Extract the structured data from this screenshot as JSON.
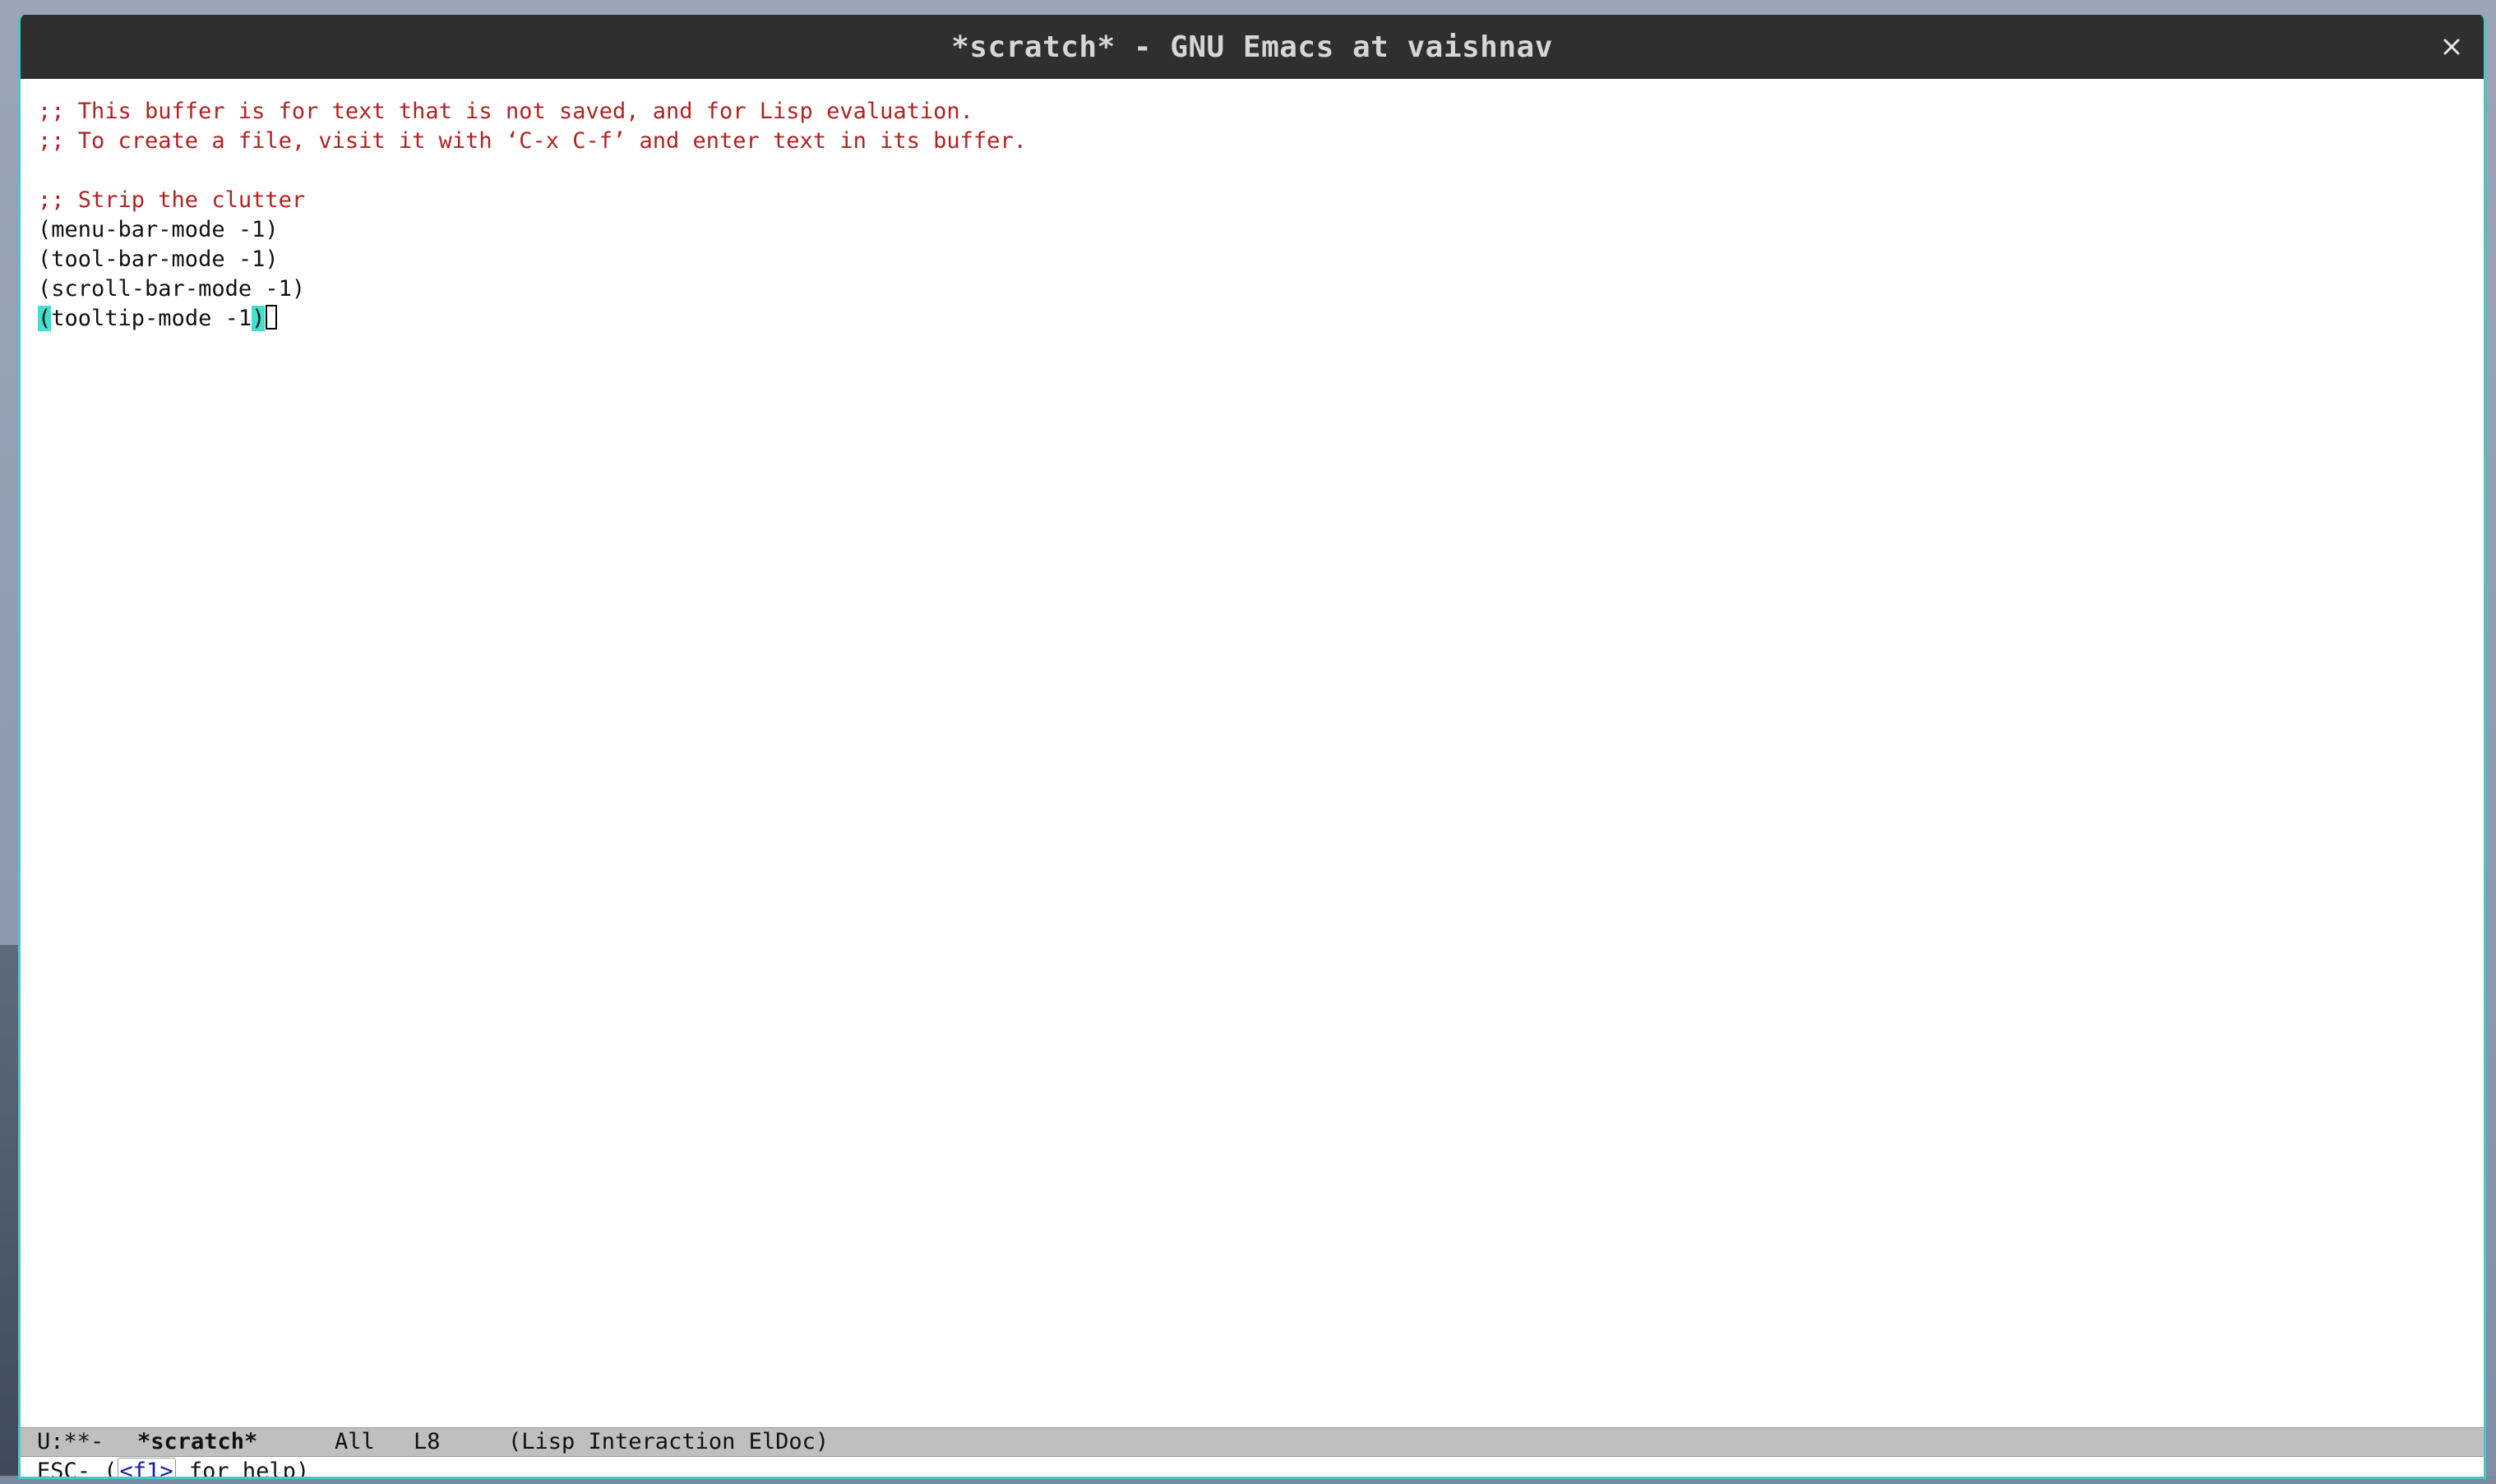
{
  "window": {
    "title": "*scratch* - GNU Emacs at vaishnav"
  },
  "buffer": {
    "lines": [
      {
        "text": ";; This buffer is for text that is not saved, and for Lisp evaluation.",
        "kind": "comment"
      },
      {
        "text": ";; To create a file, visit it with ‘C-x C-f’ and enter text in its buffer.",
        "kind": "comment"
      },
      {
        "text": "",
        "kind": "blank"
      },
      {
        "text": ";; Strip the clutter",
        "kind": "comment"
      },
      {
        "text": "(menu-bar-mode -1)",
        "kind": "code"
      },
      {
        "text": "(tool-bar-mode -1)",
        "kind": "code"
      },
      {
        "text": "(scroll-bar-mode -1)",
        "kind": "code"
      }
    ],
    "current_line": {
      "open_paren": "(",
      "body": "tooltip-mode -1",
      "close_paren": ")"
    }
  },
  "modeline": {
    "status": "U:**-",
    "buffer_name": "*scratch*",
    "position": "All",
    "line": "L8",
    "modes": "(Lisp Interaction ElDoc)"
  },
  "minibuffer": {
    "prefix": "ESC- (",
    "key": "<f1>",
    "suffix": " for help)"
  },
  "colors": {
    "comment": "#b22222",
    "paren_highlight": "#40e0d0",
    "titlebar": "#2f2f2f",
    "modeline": "#bfbfbf",
    "window_border": "#49c6c9"
  },
  "icons": {
    "close": "close-icon"
  }
}
